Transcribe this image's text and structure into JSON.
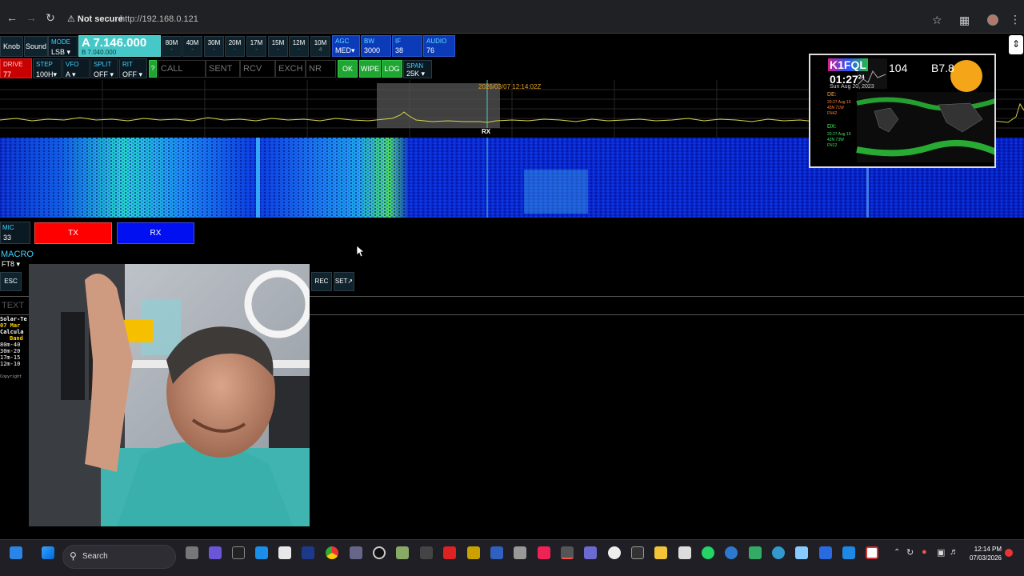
{
  "browser": {
    "security_label": "Not secure",
    "url": "http://192.168.0.121"
  },
  "controls": {
    "knob_label": "Knob",
    "sound_label": "Sound",
    "mode": {
      "label": "MODE",
      "value": "LSB"
    },
    "vfo_a": "A 7.146.000",
    "vfo_b": "B 7.040.000",
    "bands": [
      {
        "label": "80M",
        "sub": "-"
      },
      {
        "label": "40M",
        "sub": "-"
      },
      {
        "label": "30M",
        "sub": "-"
      },
      {
        "label": "20M",
        "sub": "-"
      },
      {
        "label": "17M",
        "sub": "-"
      },
      {
        "label": "15M",
        "sub": "-"
      },
      {
        "label": "12M",
        "sub": "-"
      },
      {
        "label": "10M",
        "sub": "4"
      }
    ],
    "agc": {
      "label": "AGC",
      "value": "MED"
    },
    "bw": {
      "label": "BW",
      "value": "3000"
    },
    "if": {
      "label": "IF",
      "value": "38"
    },
    "audio": {
      "label": "AUDIO",
      "value": "76"
    },
    "drive": {
      "label": "DRIVE",
      "value": "77"
    },
    "step": {
      "label": "STEP",
      "value": "100H"
    },
    "vfo": {
      "label": "VFO",
      "value": "A"
    },
    "split": {
      "label": "SPLIT",
      "value": "OFF"
    },
    "rit": {
      "label": "RIT",
      "value": "OFF"
    },
    "help_label": "?",
    "call_placeholder": "CALL",
    "sent_placeholder": "SENT",
    "rcv_placeholder": "RCV",
    "exch_placeholder": "EXCH",
    "nr_placeholder": "NR",
    "ok_label": "OK",
    "wipe_label": "WIPE",
    "log_label": "LOG",
    "span": {
      "label": "SPAN",
      "value": "25K"
    }
  },
  "spectrum": {
    "timestamp": "2026/03/07 12:14:02Z",
    "rx_marker": "RX"
  },
  "tx_panel": {
    "mic": {
      "label": "MIC",
      "value": "33"
    },
    "tx_label": "TX",
    "rx_label": "RX",
    "macro_title": "MACRO",
    "macro_select": "FT8",
    "esc_label": "ESC",
    "rec_label": "REC",
    "set_label": "SET",
    "text_placeholder": "TEXT"
  },
  "solar_text": {
    "line1": "Solar-Te",
    "line2": "07 Mar",
    "line3": "Calcula",
    "line4": "Band",
    "rows": [
      "80m-40",
      "30m-20",
      "17m-15",
      "12m-10"
    ],
    "footer": "Copyright"
  },
  "dx_widget": {
    "callsign": "K1FQL",
    "time": "01:27",
    "seconds": "24",
    "date": "Sun Aug 20, 2023",
    "sfi": "104",
    "xray": "B7.8",
    "de_label": "DE:",
    "dx_label": "DX:",
    "de_lines": [
      "20:27 Aug 19",
      "45N 71W",
      "FN42"
    ],
    "dx_lines": [
      "20:27 Aug 19",
      "42N 73W",
      "FN12"
    ]
  },
  "taskbar": {
    "search_label": "Search",
    "time": "12:14 PM",
    "date": "07/03/2026"
  }
}
